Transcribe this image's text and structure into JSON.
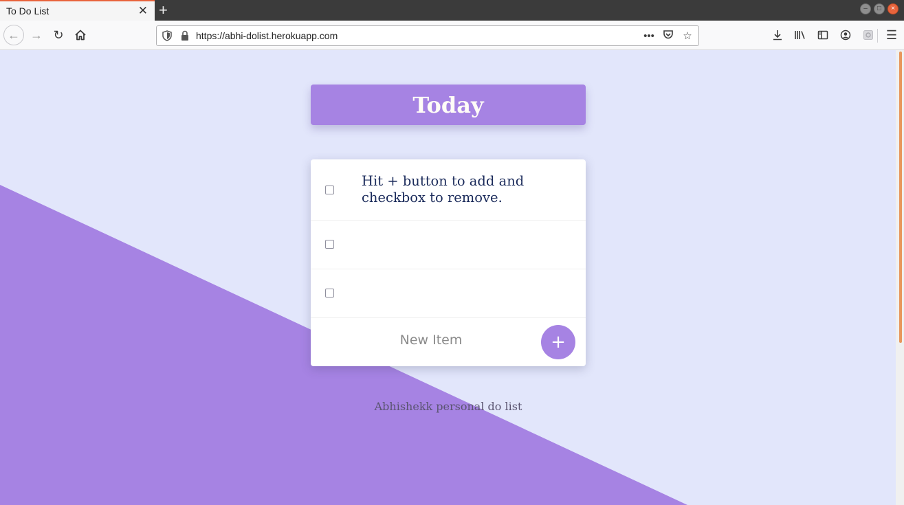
{
  "browser": {
    "tab_title": "To Do List",
    "tab_close": "✕",
    "new_tab": "+",
    "url": "https://abhi-dolist.herokuapp.com",
    "page_actions": "•••"
  },
  "page": {
    "heading": "Today",
    "items": [
      {
        "text": "Hit + button to add and checkbox to remove.",
        "checked": false
      },
      {
        "text": "",
        "checked": false
      },
      {
        "text": "",
        "checked": false
      }
    ],
    "new_item_placeholder": "New Item",
    "add_label": "+",
    "footer": "Abhishekk personal do list"
  },
  "colors": {
    "accent": "#a683e3",
    "page_background": "#e2e6fb",
    "heading_text": "#fffcf7",
    "item_text": "#1a2a5a"
  }
}
